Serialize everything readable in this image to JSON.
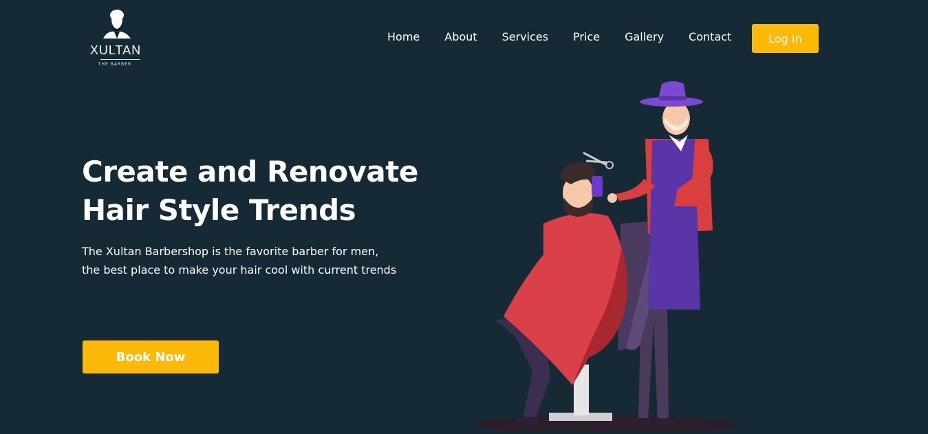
{
  "logo": {
    "name": "XULTAN",
    "tagline": "THE BARBER"
  },
  "nav": {
    "items": [
      "Home",
      "About",
      "Services",
      "Price",
      "Gallery",
      "Contact"
    ],
    "login_label": "Log In"
  },
  "hero": {
    "title_line1": "Create and Renovate",
    "title_line2": "Hair Style Trends",
    "desc_line1": "The Xultan Barbershop is the favorite barber for men,",
    "desc_line2": "the best place to make your hair cool with current trends",
    "cta_label": "Book Now"
  },
  "colors": {
    "background": "#152a35",
    "accent": "#fcb908",
    "text": "#ffffff"
  }
}
